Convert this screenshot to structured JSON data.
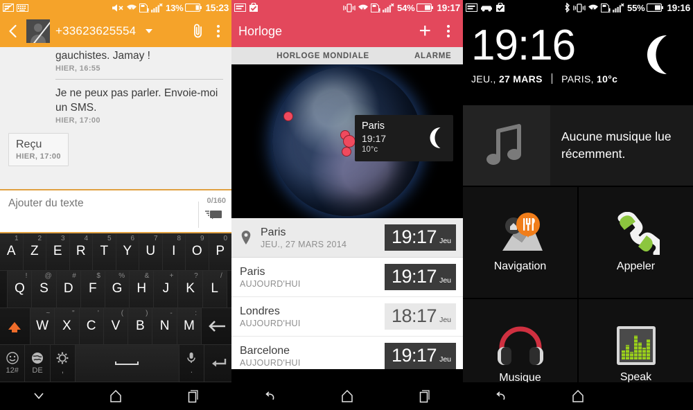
{
  "panels": {
    "sms": {
      "statusbar": {
        "left_icons": [
          "sms-unread-icon",
          "keyboard-icon"
        ],
        "right_icons": [
          "mute-icon",
          "wifi-icon",
          "sdcard-alert-icon",
          "signal-no-service-icon",
          "battery-icon"
        ],
        "battery_pct": "13%",
        "time": "15:23",
        "bg_color": "#f5a32a"
      },
      "appbar": {
        "back_icon": "back-chevron-icon",
        "avatar": "contact-avatar",
        "contact": "+33623625554",
        "dropdown_icon": "chevron-down-icon",
        "attach_icon": "paperclip-icon",
        "overflow_icon": "more-vertical-icon"
      },
      "messages": [
        {
          "text": "gauchistes. Jamay !",
          "time": "HIER, 16:55",
          "truncated_above": true
        },
        {
          "text": "Je ne peux pas parler. Envoie-moi un SMS.",
          "time": "HIER, 17:00"
        }
      ],
      "receipt": {
        "label": "Reçu",
        "time": "HIER, 17:00"
      },
      "compose": {
        "placeholder": "Ajouter du texte",
        "value": "",
        "counter": "0/160",
        "send_icon": "send-message-icon"
      },
      "keyboard": {
        "row1": [
          {
            "key": "A",
            "sup": "1"
          },
          {
            "key": "Z",
            "sup": "2"
          },
          {
            "key": "E",
            "sup": "3"
          },
          {
            "key": "R",
            "sup": "4"
          },
          {
            "key": "T",
            "sup": "5"
          },
          {
            "key": "Y",
            "sup": "6"
          },
          {
            "key": "U",
            "sup": "7"
          },
          {
            "key": "I",
            "sup": "8"
          },
          {
            "key": "O",
            "sup": "9"
          },
          {
            "key": "P",
            "sup": "0"
          }
        ],
        "row2": [
          {
            "key": "Q",
            "sup": "!"
          },
          {
            "key": "S",
            "sup": "@"
          },
          {
            "key": "D",
            "sup": "#"
          },
          {
            "key": "F",
            "sup": "$"
          },
          {
            "key": "G",
            "sup": "%"
          },
          {
            "key": "H",
            "sup": "&"
          },
          {
            "key": "J",
            "sup": "+"
          },
          {
            "key": "K",
            "sup": "?"
          },
          {
            "key": "L",
            "sup": "/"
          }
        ],
        "row3": [
          {
            "key": "W",
            "sup": "~"
          },
          {
            "key": "X",
            "sup": "\""
          },
          {
            "key": "C",
            "sup": "'"
          },
          {
            "key": "V",
            "sup": "("
          },
          {
            "key": "B",
            "sup": ")"
          },
          {
            "key": "N",
            "sup": "-"
          },
          {
            "key": "M",
            "sup": ":"
          }
        ],
        "shift_icon": "shift-up-icon",
        "backspace_icon": "backspace-icon",
        "emoji_icon": "emoji-smiley-icon",
        "emoji_label": "12#",
        "lang_icon": "globe-language-icon",
        "lang_label": "DE",
        "settings_icon": "gear-icon",
        "settings_label": ",",
        "space_label": "",
        "mic_icon": "microphone-icon",
        "mic_label": ".",
        "enter_icon": "enter-return-icon"
      },
      "navbar": [
        "hide-keyboard-icon",
        "home-icon",
        "recents-icon"
      ]
    },
    "clock": {
      "statusbar": {
        "left_icons": [
          "message-icon",
          "play-store-icon"
        ],
        "right_icons": [
          "vibrate-icon",
          "wifi-icon",
          "sdcard-alert-icon",
          "signal-no-service-icon",
          "battery-icon"
        ],
        "battery_pct": "54%",
        "time": "19:17",
        "bg_color": "#e3485c"
      },
      "appbar": {
        "title": "Horloge",
        "add_icon": "plus-icon",
        "overflow_icon": "more-vertical-icon"
      },
      "tabs": [
        {
          "label": "HORLOGE MONDIALE",
          "active": true
        },
        {
          "label": "ALARME",
          "active": false
        }
      ],
      "globe": {
        "markers": 4,
        "tooltip": {
          "city": "Paris",
          "time": "19:17",
          "temp": "10°c",
          "weather_icon": "moon-icon"
        }
      },
      "cities": [
        {
          "name": "Paris",
          "sub": "JEU., 27 MARS 2014",
          "time": "19:17",
          "day": "Jeu",
          "current": true,
          "night": true
        },
        {
          "name": "Paris",
          "sub": "AUJOURD'HUI",
          "time": "19:17",
          "day": "Jeu",
          "current": false,
          "night": true
        },
        {
          "name": "Londres",
          "sub": "AUJOURD'HUI",
          "time": "18:17",
          "day": "Jeu",
          "current": false,
          "night": false
        },
        {
          "name": "Barcelone",
          "sub": "AUJOURD'HUI",
          "time": "19:17",
          "day": "Jeu",
          "current": false,
          "night": true
        }
      ],
      "navbar": [
        "back-icon",
        "home-icon",
        "recents-icon"
      ]
    },
    "car": {
      "statusbar": {
        "left_icons": [
          "message-icon",
          "car-mode-icon",
          "play-store-icon"
        ],
        "right_icons": [
          "bluetooth-icon",
          "vibrate-icon",
          "wifi-icon",
          "sdcard-alert-icon",
          "signal-no-service-icon",
          "battery-icon"
        ],
        "battery_pct": "55%",
        "time": "19:16",
        "bg_color": "#000000"
      },
      "clock": {
        "time": "19:16",
        "date_prefix": "JEU.,",
        "date_main": "27 MARS",
        "city": "PARIS,",
        "temp": "10°c",
        "weather_icon": "moon-icon"
      },
      "music": {
        "icon": "music-note-icon",
        "text": "Aucune musique lue récemment."
      },
      "tiles": [
        {
          "label": "Navigation",
          "icon": "map-pin-navigation-icon"
        },
        {
          "label": "Appeler",
          "icon": "phone-handset-icon"
        },
        {
          "label": "Musique",
          "icon": "headphones-icon"
        },
        {
          "label": "Speak",
          "icon": "equalizer-icon"
        }
      ],
      "navbar": [
        "back-icon",
        "home-icon"
      ]
    }
  }
}
